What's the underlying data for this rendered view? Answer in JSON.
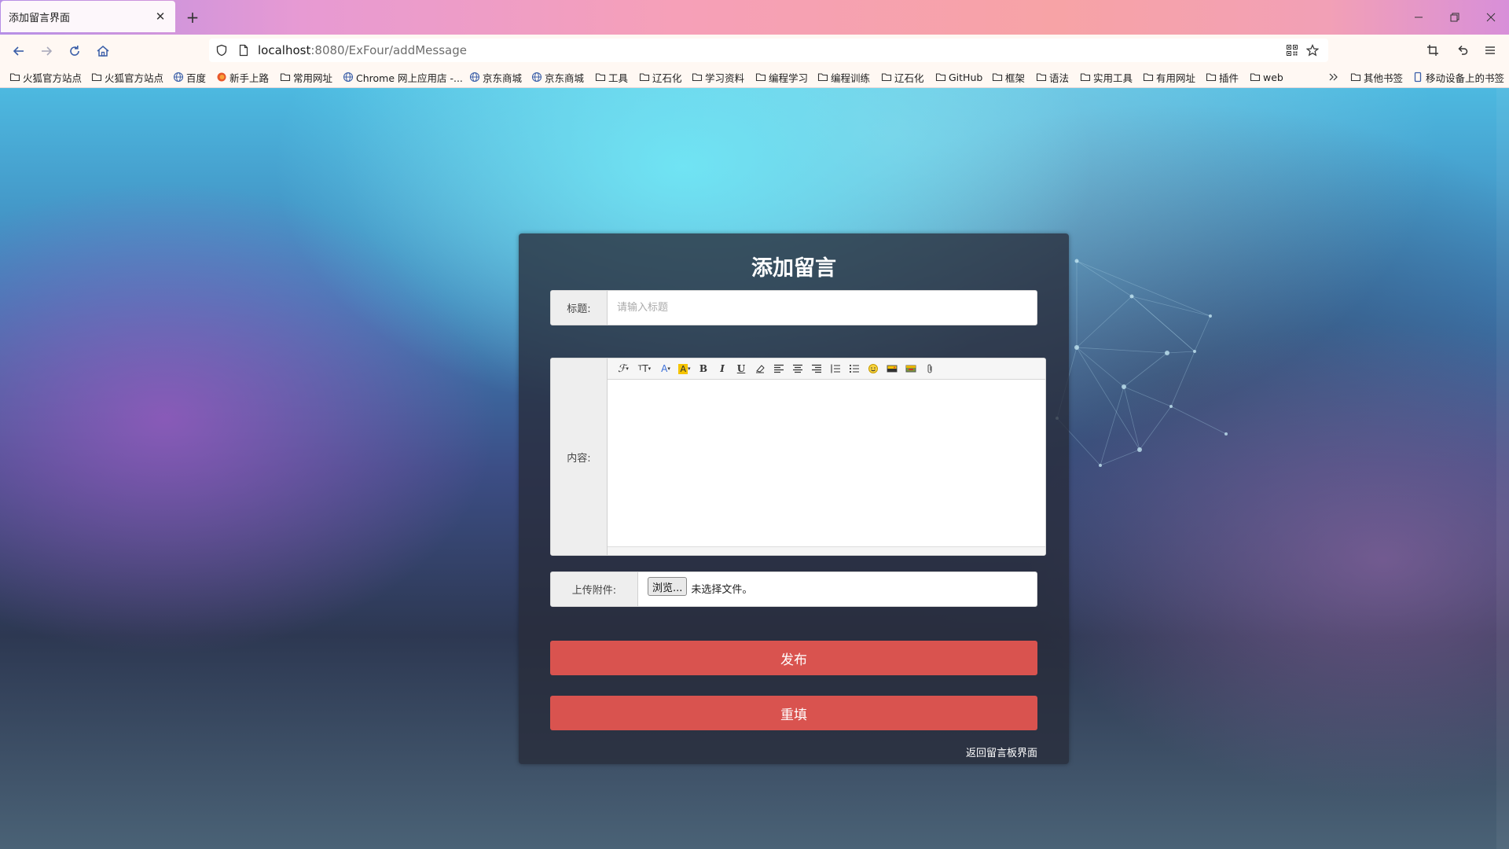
{
  "browser": {
    "tab_title": "添加留言界面",
    "url_host": "localhost",
    "url_rest": ":8080/ExFour/addMessage",
    "bookmarks": [
      {
        "label": "火狐官方站点",
        "icon": "folder-icon"
      },
      {
        "label": "火狐官方站点",
        "icon": "folder-icon"
      },
      {
        "label": "百度",
        "icon": "globe-icon"
      },
      {
        "label": "新手上路",
        "icon": "firefox-icon"
      },
      {
        "label": "常用网址",
        "icon": "folder-icon"
      },
      {
        "label": "Chrome 网上应用店 -...",
        "icon": "globe-icon"
      },
      {
        "label": "京东商城",
        "icon": "globe-icon"
      },
      {
        "label": "京东商城",
        "icon": "globe-icon"
      },
      {
        "label": "工具",
        "icon": "folder-icon"
      },
      {
        "label": "辽石化",
        "icon": "folder-icon"
      },
      {
        "label": "学习资料",
        "icon": "folder-icon"
      },
      {
        "label": "编程学习",
        "icon": "folder-icon"
      },
      {
        "label": "编程训练",
        "icon": "folder-icon"
      },
      {
        "label": "辽石化",
        "icon": "folder-icon"
      },
      {
        "label": "GitHub",
        "icon": "folder-icon"
      },
      {
        "label": "框架",
        "icon": "folder-icon"
      },
      {
        "label": "语法",
        "icon": "folder-icon"
      },
      {
        "label": "实用工具",
        "icon": "folder-icon"
      },
      {
        "label": "有用网址",
        "icon": "folder-icon"
      },
      {
        "label": "插件",
        "icon": "folder-icon"
      },
      {
        "label": "web",
        "icon": "folder-icon"
      }
    ],
    "other_bookmarks": "其他书签",
    "mobile_bookmarks": "移动设备上的书签"
  },
  "form": {
    "heading": "添加留言",
    "title_label": "标题:",
    "title_placeholder": "请输入标题",
    "title_value": "",
    "content_label": "内容:",
    "toolbar_icons": [
      "font-family-icon",
      "font-size-icon",
      "font-color-icon",
      "highlight-color-icon",
      "bold-icon",
      "italic-icon",
      "underline-icon",
      "eraser-icon",
      "align-left-icon",
      "align-center-icon",
      "align-right-icon",
      "ordered-list-icon",
      "unordered-list-icon",
      "emoticon-icon",
      "insert-image-icon",
      "insert-media-icon",
      "attachment-icon"
    ],
    "attachment_label": "上传附件:",
    "browse_button": "浏览...",
    "file_status": "未选择文件。",
    "publish_button": "发布",
    "reset_button": "重填",
    "back_link": "返回留言板界面"
  },
  "colors": {
    "button_red": "#d9534f",
    "card_bg": "rgba(40,44,58,0.78)"
  }
}
